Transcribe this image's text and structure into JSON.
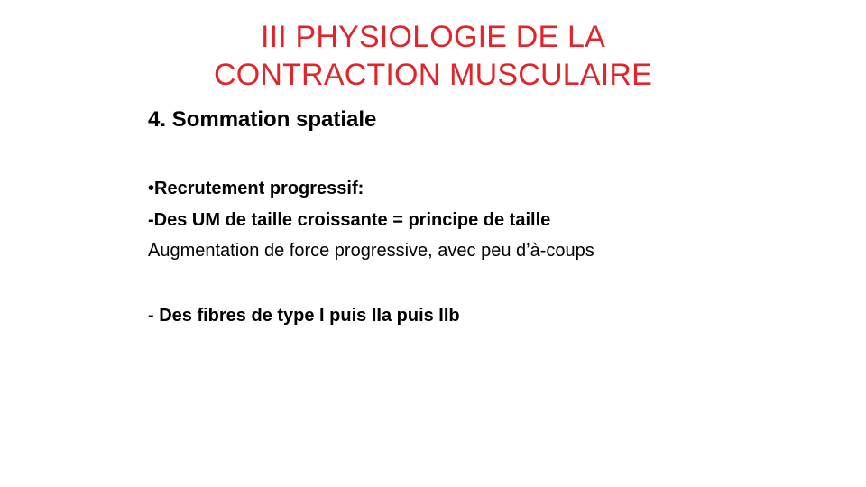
{
  "slide": {
    "title_line1": "III PHYSIOLOGIE DE LA",
    "title_line2": "CONTRACTION MUSCULAIRE",
    "heading": "4. Sommation spatiale",
    "body": [
      "•Recrutement progressif:",
      "-Des UM de taille croissante = principe de taille",
      "Augmentation de force progressive, avec peu d’à-coups",
      "- Des fibres de type I puis IIa puis IIb"
    ]
  },
  "colors": {
    "title": "#e0262b",
    "text": "#000000",
    "background": "#ffffff"
  }
}
